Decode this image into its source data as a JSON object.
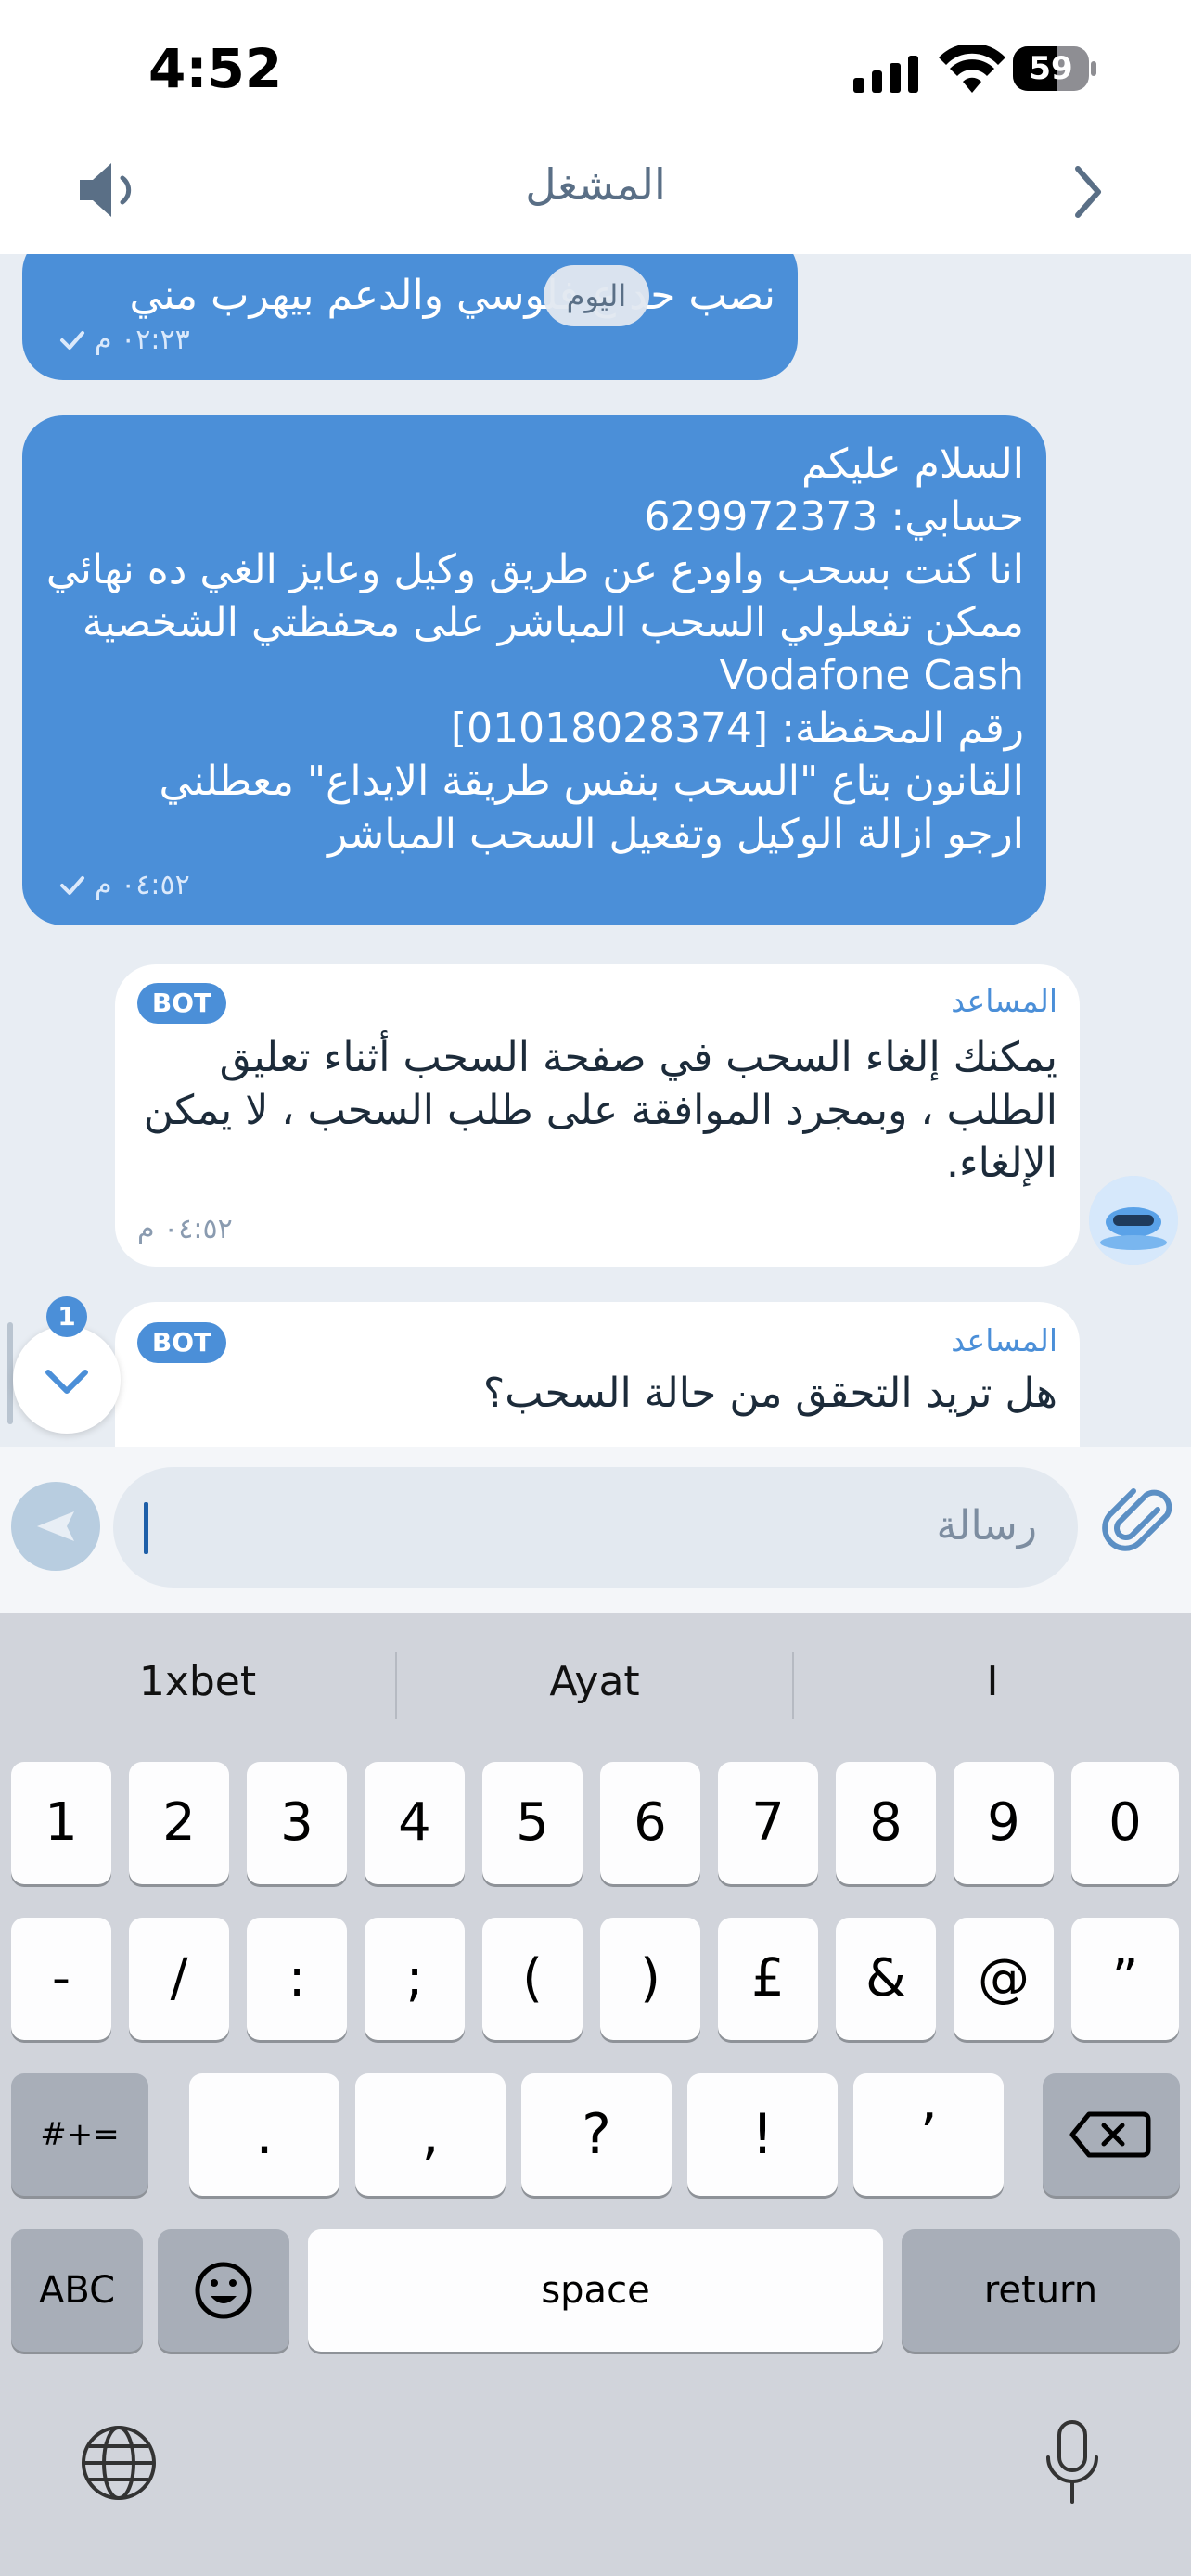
{
  "status_bar": {
    "time": "4:52",
    "battery": "59",
    "battery_level": 0.59
  },
  "header": {
    "title": "المشغل"
  },
  "chat": {
    "date_pill": "اليوم",
    "messages": [
      {
        "id": "m1",
        "direction": "out",
        "text": "نصب حد ع فلوسي والدعم بيهرب مني",
        "time": "٠٢:٢٣ م"
      },
      {
        "id": "m2",
        "direction": "out",
        "lines": [
          "السلام عليكم",
          "حسابي: 629972373",
          "انا كنت بسحب واودع عن طريق وكيل وعايز الغي ده نهائي",
          "ممكن تفعلولي السحب المباشر على محفظتي الشخصية",
          "Vodafone Cash",
          "رقم المحفظة: [01018028374]",
          "القانون بتاع \"السحب بنفس طريقة الايداع\" معطلني",
          "ارجو ازالة الوكيل وتفعيل السحب المباشر"
        ],
        "time": "٠٤:٥٢ م"
      },
      {
        "id": "m3",
        "direction": "in",
        "sender": "المساعد",
        "badge": "BOT",
        "lines": [
          "يمكنك إلغاء السحب في صفحة السحب أثناء تعليق",
          "الطلب ، وبمجرد الموافقة على طلب السحب ، لا يمكن",
          "الإلغاء."
        ],
        "time": "٠٤:٥٢ م"
      },
      {
        "id": "m4",
        "direction": "in",
        "sender": "المساعد",
        "badge": "BOT",
        "lines": [
          "هل تريد التحقق من حالة السحب؟"
        ]
      }
    ],
    "scroll_down_badge": "1"
  },
  "composer": {
    "placeholder": "رسالة"
  },
  "keyboard": {
    "suggestions": [
      "1xbet",
      "Ayat",
      "I"
    ],
    "row1": [
      "1",
      "2",
      "3",
      "4",
      "5",
      "6",
      "7",
      "8",
      "9",
      "0"
    ],
    "row2": [
      "-",
      "/",
      ":",
      ";",
      "(",
      ")",
      "£",
      "&",
      "@",
      "”"
    ],
    "row3_left": "#+=",
    "row3": [
      ".",
      ",",
      "?",
      "!",
      "’"
    ],
    "abc": "ABC",
    "space": "space",
    "return": "return"
  },
  "colors": {
    "accent": "#4b8fd8",
    "background": "#e8edf3",
    "keyboard": "#d1d4db"
  }
}
